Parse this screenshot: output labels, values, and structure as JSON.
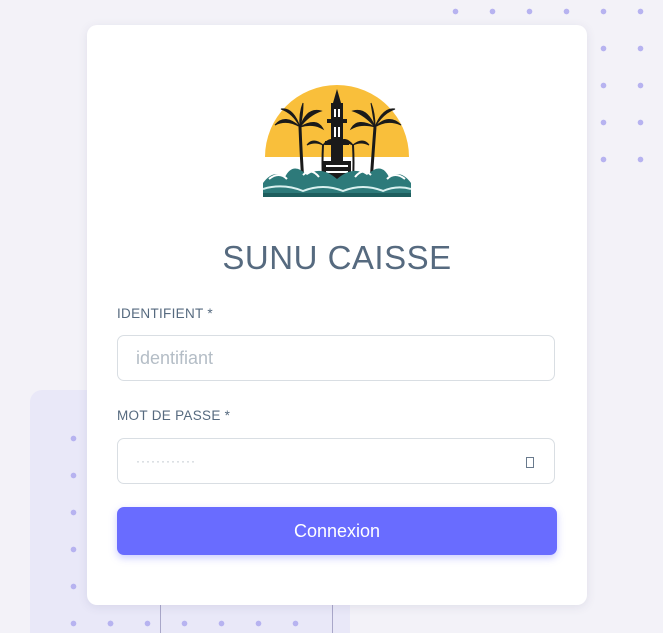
{
  "brand": {
    "title": "SUNU CAISSE",
    "logo_icon": "beach-monument-logo-icon",
    "colors": {
      "sun": "#f9bf3b",
      "wave": "#2d7a7a",
      "accent": "#696cff",
      "text": "#566a7f"
    }
  },
  "form": {
    "identifier_label": "IDENTIFIENT *",
    "identifier_placeholder": "identifiant",
    "identifier_value": "",
    "password_label": "MOT DE PASSE *",
    "password_placeholder": "············",
    "password_value": "",
    "password_toggle_icon": "eye-toggle-icon",
    "submit_label": "Connexion"
  }
}
